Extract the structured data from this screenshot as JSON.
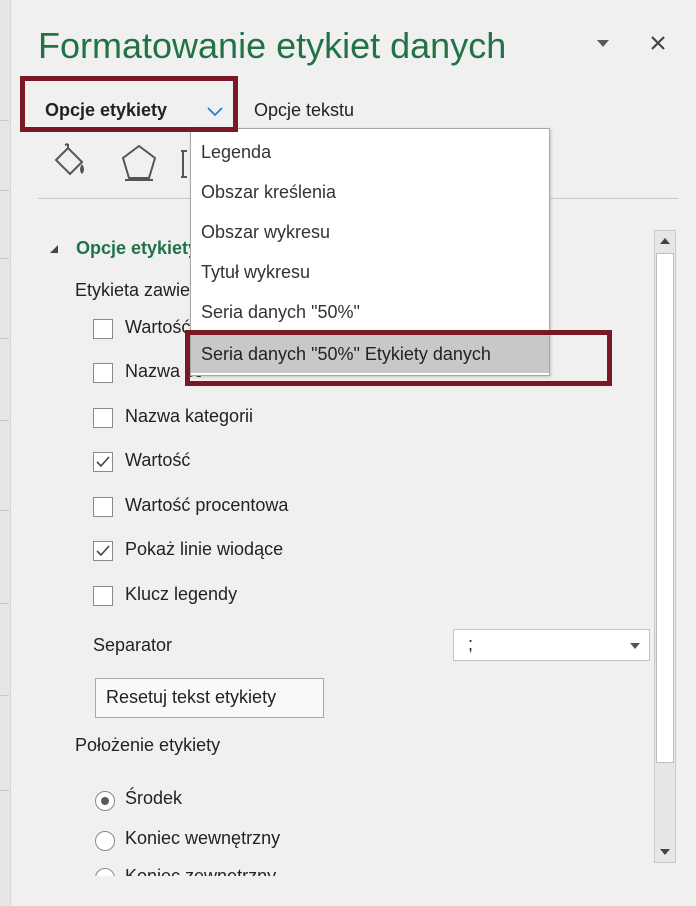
{
  "pane": {
    "title": "Formatowanie etykiet danych",
    "tabs": [
      {
        "label": "Opcje etykiety"
      },
      {
        "label": "Opcje tekstu"
      }
    ]
  },
  "dropdown": {
    "items": [
      {
        "label": "Legenda"
      },
      {
        "label": "Obszar kreślenia"
      },
      {
        "label": "Obszar wykresu"
      },
      {
        "label": "Tytuł wykresu"
      },
      {
        "label": "Seria danych \"50%\""
      },
      {
        "label": "Seria danych \"50%\" Etykiety danych"
      }
    ],
    "selected_index": 5
  },
  "section": {
    "title": "Opcje etykiety",
    "label_contains": "Etykieta zawiera"
  },
  "checkboxes": [
    {
      "label": "Wartość z komórek",
      "checked": false
    },
    {
      "label": "Nazwa serii",
      "checked": false
    },
    {
      "label": "Nazwa kategorii",
      "checked": false
    },
    {
      "label": "Wartość",
      "checked": true
    },
    {
      "label": "Wartość procentowa",
      "checked": false
    },
    {
      "label": "Pokaż linie wiodące",
      "checked": true
    },
    {
      "label": "Klucz legendy",
      "checked": false
    }
  ],
  "separator": {
    "label": "Separator",
    "value": ";"
  },
  "reset_button": {
    "label": "Resetuj tekst etykiety"
  },
  "position": {
    "label": "Położenie etykiety",
    "options": [
      {
        "label": "Środek",
        "selected": true
      },
      {
        "label": "Koniec wewnętrzny",
        "selected": false
      },
      {
        "label": "Koniec zewnętrzny",
        "selected": false
      }
    ]
  },
  "colors": {
    "accent_green": "#217346",
    "highlight_border": "#7b1828"
  },
  "icons": [
    "fill-line-icon",
    "effects-pentagon-icon",
    "size-properties-icon",
    "chevron-down-icon",
    "close-icon",
    "collapse-triangle-icon",
    "scroll-up-icon",
    "scroll-down-icon"
  ]
}
